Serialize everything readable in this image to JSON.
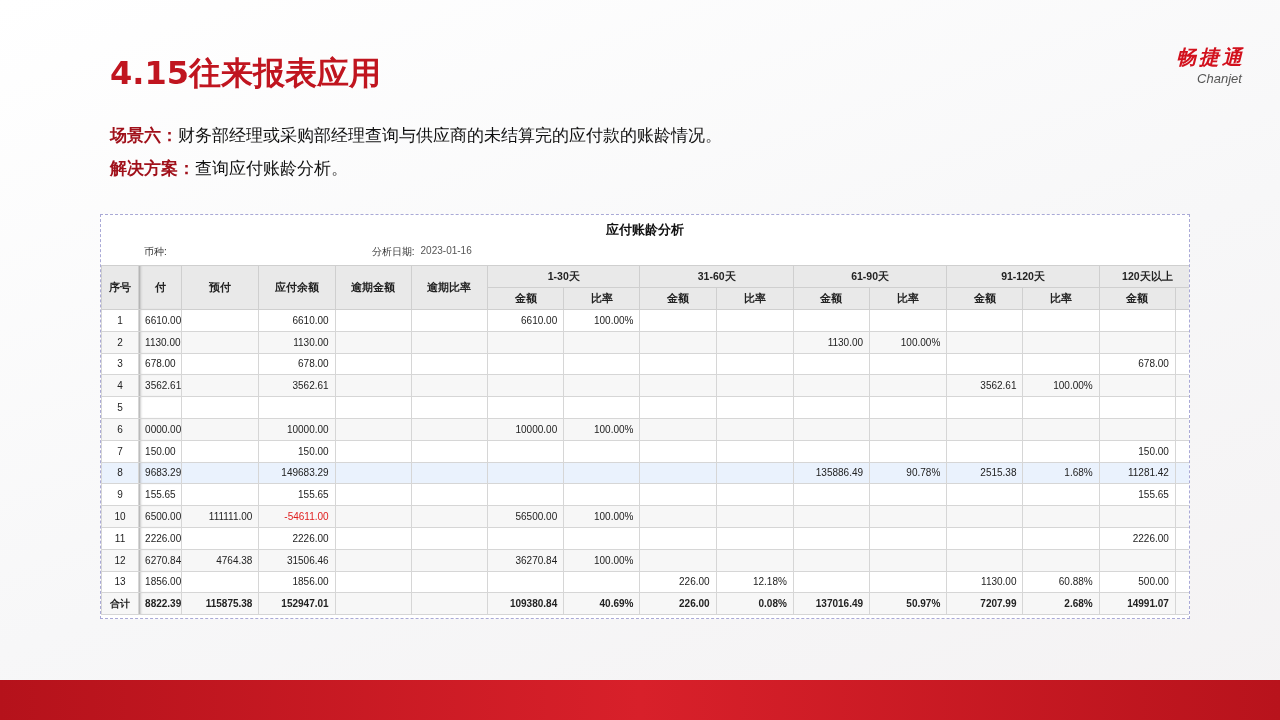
{
  "slide": {
    "title": "4.15往来报表应用",
    "logo_name": "畅捷通",
    "logo_sub": "Chanjet"
  },
  "scenario": {
    "label": "场景六：",
    "text": "财务部经理或采购部经理查询与供应商的未结算完的应付款的账龄情况。"
  },
  "solution": {
    "label": "解决方案：",
    "text": "查询应付账龄分析。"
  },
  "report": {
    "title": "应付账龄分析",
    "currency_label": "币种:",
    "date_label": "分析日期:",
    "date": "2023-01-16",
    "columns": [
      "序号",
      "付",
      "预付",
      "应付余额",
      "逾期金额",
      "逾期比率"
    ],
    "groups": [
      "1-30天",
      "31-60天",
      "61-90天",
      "91-120天",
      "120天以上"
    ],
    "subheaders": [
      "金额",
      "比率",
      "金额",
      "比率",
      "金额",
      "比率",
      "金额",
      "比率",
      "金额"
    ],
    "rows": [
      {
        "selected": false,
        "balance_negative": false,
        "cells": [
          "1",
          "6610.00",
          null,
          "6610.00",
          null,
          null,
          "6610.00",
          "100.00%",
          null,
          null,
          null,
          null,
          null,
          null,
          null
        ]
      },
      {
        "selected": false,
        "balance_negative": false,
        "cells": [
          "2",
          "1130.00",
          null,
          "1130.00",
          null,
          null,
          null,
          null,
          null,
          null,
          "1130.00",
          "100.00%",
          null,
          null,
          null
        ]
      },
      {
        "selected": false,
        "balance_negative": false,
        "cells": [
          "3",
          "678.00",
          null,
          "678.00",
          null,
          null,
          null,
          null,
          null,
          null,
          null,
          null,
          null,
          null,
          "678.00"
        ]
      },
      {
        "selected": false,
        "balance_negative": false,
        "cells": [
          "4",
          "3562.61",
          null,
          "3562.61",
          null,
          null,
          null,
          null,
          null,
          null,
          null,
          null,
          "3562.61",
          "100.00%",
          null
        ]
      },
      {
        "selected": false,
        "cells": [
          "5",
          null,
          null,
          null,
          null,
          null,
          null,
          null,
          null,
          null,
          null,
          null,
          null,
          null,
          null
        ]
      },
      {
        "selected": false,
        "balance_negative": false,
        "cells": [
          "6",
          "0000.00",
          null,
          "10000.00",
          null,
          null,
          "10000.00",
          "100.00%",
          null,
          null,
          null,
          null,
          null,
          null,
          null
        ]
      },
      {
        "selected": false,
        "balance_negative": false,
        "cells": [
          "7",
          "150.00",
          null,
          "150.00",
          null,
          null,
          null,
          null,
          null,
          null,
          null,
          null,
          null,
          null,
          "150.00"
        ]
      },
      {
        "selected": true,
        "balance_negative": false,
        "cells": [
          "8",
          "9683.29",
          null,
          "149683.29",
          null,
          null,
          null,
          null,
          null,
          null,
          "135886.49",
          "90.78%",
          "2515.38",
          "1.68%",
          "11281.42"
        ]
      },
      {
        "selected": false,
        "balance_negative": false,
        "cells": [
          "9",
          "155.65",
          null,
          "155.65",
          null,
          null,
          null,
          null,
          null,
          null,
          null,
          null,
          null,
          null,
          "155.65"
        ]
      },
      {
        "selected": false,
        "balance_negative": true,
        "cells": [
          "10",
          "6500.00",
          "111111.00",
          "-54611.00",
          null,
          null,
          "56500.00",
          "100.00%",
          null,
          null,
          null,
          null,
          null,
          null,
          null
        ]
      },
      {
        "selected": false,
        "balance_negative": false,
        "cells": [
          "11",
          "2226.00",
          null,
          "2226.00",
          null,
          null,
          null,
          null,
          null,
          null,
          null,
          null,
          null,
          null,
          "2226.00"
        ]
      },
      {
        "selected": false,
        "balance_negative": false,
        "cells": [
          "12",
          "6270.84",
          "4764.38",
          "31506.46",
          null,
          null,
          "36270.84",
          "100.00%",
          null,
          null,
          null,
          null,
          null,
          null,
          null
        ]
      },
      {
        "selected": false,
        "balance_negative": false,
        "cells": [
          "13",
          "1856.00",
          null,
          "1856.00",
          null,
          null,
          null,
          null,
          "226.00",
          "12.18%",
          null,
          null,
          "1130.00",
          "60.88%",
          "500.00"
        ]
      }
    ],
    "total": {
      "cells": [
        "合计",
        "8822.39",
        "115875.38",
        "152947.01",
        null,
        null,
        "109380.84",
        "40.69%",
        "226.00",
        "0.08%",
        "137016.49",
        "50.97%",
        "7207.99",
        "2.68%",
        "14991.07"
      ]
    }
  }
}
